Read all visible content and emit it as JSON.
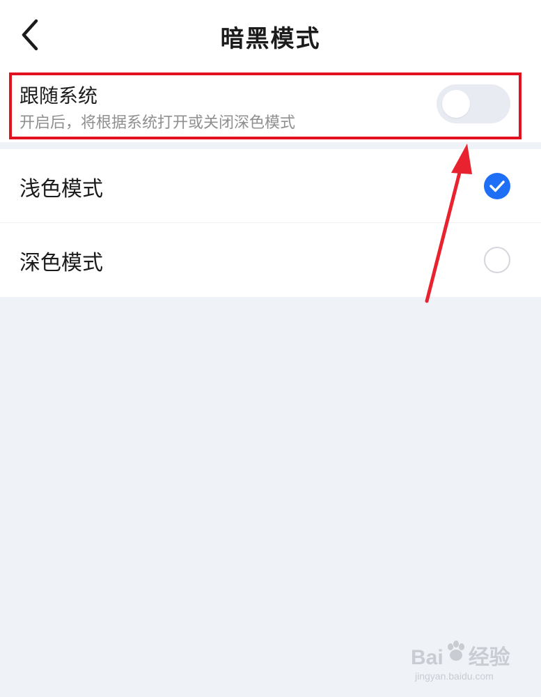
{
  "header": {
    "title": "暗黑模式",
    "back_icon": "chevron-left-icon"
  },
  "follow_system": {
    "title": "跟随系统",
    "subtitle": "开启后，将根据系统打开或关闭深色模式",
    "toggle_on": false
  },
  "options": [
    {
      "label": "浅色模式",
      "selected": true
    },
    {
      "label": "深色模式",
      "selected": false
    }
  ],
  "annotation": {
    "box_color": "#e1111f",
    "arrow_color": "#e8232f"
  },
  "watermark": {
    "brand": "Bai",
    "brand_suffix": "经验",
    "url": "jingyan.baidu.com"
  },
  "colors": {
    "accent": "#1e6ff5",
    "background": "#eff2f7"
  }
}
